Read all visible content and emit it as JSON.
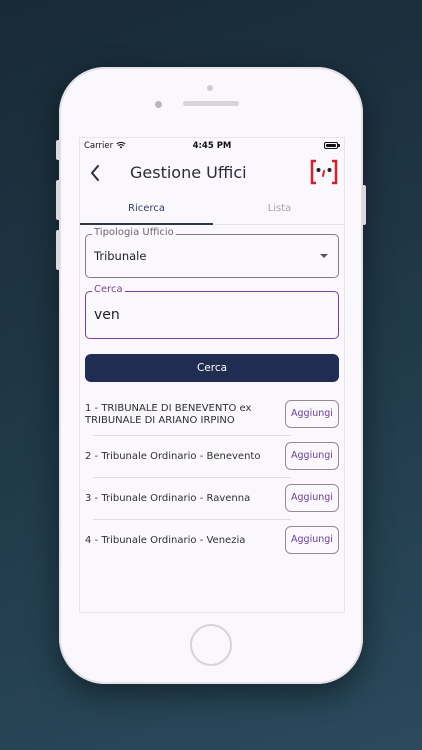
{
  "status_bar": {
    "carrier": "Carrier",
    "time": "4:45 PM"
  },
  "app_bar": {
    "title": "Gestione Uffici"
  },
  "tabs": [
    {
      "label": "Ricerca",
      "active": true
    },
    {
      "label": "Lista",
      "active": false
    }
  ],
  "office_type": {
    "label": "Tipologia Ufficio",
    "value": "Tribunale"
  },
  "search": {
    "label": "Cerca",
    "value": "ven",
    "button_label": "Cerca"
  },
  "results": [
    {
      "text": "1 - TRIBUNALE DI BENEVENTO ex TRIBUNALE DI ARIANO IRPINO",
      "button_label": "Aggiungi"
    },
    {
      "text": "2 - Tribunale Ordinario - Benevento",
      "button_label": "Aggiungi"
    },
    {
      "text": "3 - Tribunale Ordinario - Ravenna",
      "button_label": "Aggiungi"
    },
    {
      "text": "4 - Tribunale Ordinario - Venezia",
      "button_label": "Aggiungi"
    }
  ],
  "colors": {
    "primary": "#1f2d52",
    "accent": "#7a3f98",
    "logo_red": "#d8202a"
  }
}
